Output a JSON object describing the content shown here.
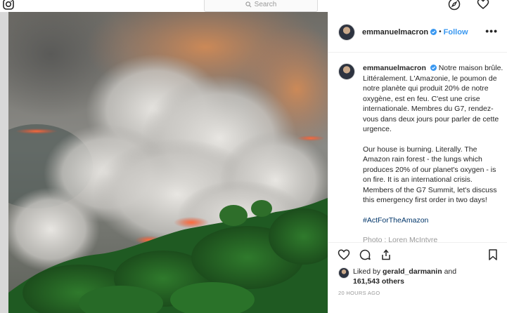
{
  "nav": {
    "search_placeholder": "Search"
  },
  "post": {
    "username": "emmanuelmacron",
    "follow_label": "Follow",
    "separator": "•",
    "more_label": "•••",
    "caption_french": "Notre maison brûle. Littéralement. L'Amazonie, le poumon de notre planète qui produit 20% de notre oxygène, est en feu. C'est une crise internationale. Membres du G7, rendez-vous dans deux jours pour parler de cette urgence.",
    "caption_english": "Our house is burning. Literally. The Amazon rain forest - the lungs which produces 20% of our planet's oxygen - is on fire. It is an international crisis. Members of the G7 Summit, let's discuss this emergency first order in two days!",
    "hashtag": "#ActForTheAmazon",
    "photo_credit": "Photo : Loren McIntyre",
    "liked_by_prefix": "Liked by",
    "liked_by_user": "gerald_darmanin",
    "liked_by_and": "and",
    "likes_count": "161,543 others",
    "timestamp": "20 HOURS AGO"
  },
  "colors": {
    "link_blue": "#3897f0",
    "hashtag_blue": "#003569",
    "verified_blue": "#3897f0"
  },
  "icons": [
    "instagram-icon",
    "search-icon",
    "compass-icon",
    "heart-icon",
    "verified-icon",
    "comment-icon",
    "share-icon",
    "bookmark-icon"
  ]
}
